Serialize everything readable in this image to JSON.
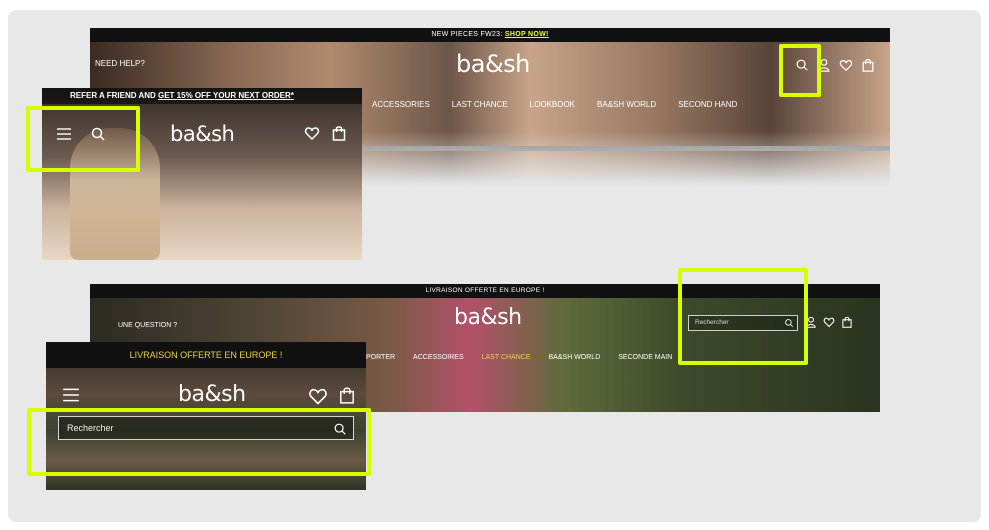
{
  "colors": {
    "highlight": "#d8ff00",
    "promo_link": "#e9ff3d",
    "shipping_text": "#e9d34c",
    "bar": "#111111"
  },
  "desktop_top": {
    "promo_text": "NEW PIECES FW23: ",
    "promo_link": "SHOP NOW!",
    "help": "NEED HELP?",
    "logo": "ba&sh",
    "nav": [
      "ACCESSORIES",
      "LAST CHANCE",
      "LOOKBOOK",
      "BA&SH WORLD",
      "SECOND HAND"
    ],
    "icons": [
      "search-icon",
      "user-icon",
      "heart-icon",
      "bag-icon"
    ]
  },
  "mobile_top": {
    "referral_prefix": "REFER A FRIEND AND ",
    "referral_link": "GET 15% OFF YOUR NEXT ORDER*",
    "logo": "ba&sh",
    "icons": [
      "menu-icon",
      "search-icon",
      "heart-icon",
      "bag-icon"
    ]
  },
  "desktop_search": {
    "promo_text": "LIVRAISON OFFERTE EN EUROPE !",
    "help": "UNE QUESTION ?",
    "logo": "ba&sh",
    "search_placeholder": "Rechercher",
    "nav": [
      "PORTER",
      "ACCESSOIRES",
      "LAST CHANCE",
      "BA&SH WORLD",
      "SECONDE MAIN"
    ]
  },
  "mobile_search": {
    "shipping_text": "LIVRAISON OFFERTE EN EUROPE !",
    "logo": "ba&sh",
    "search_placeholder": "Rechercher"
  }
}
